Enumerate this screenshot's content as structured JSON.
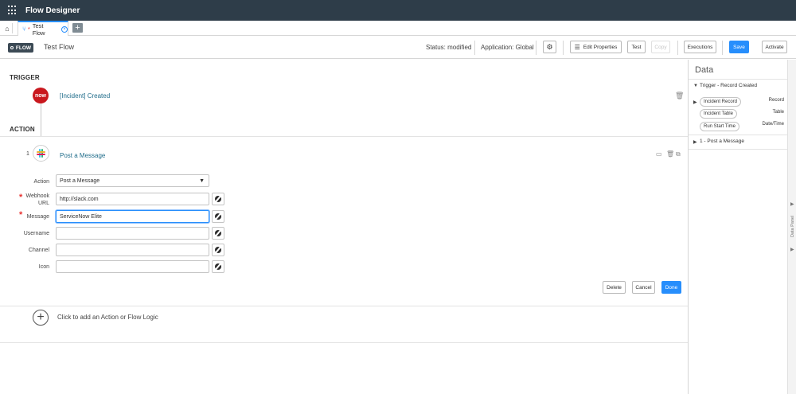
{
  "app": {
    "title": "Flow Designer"
  },
  "tabs": {
    "active_label": "Test Flow",
    "active_prefix": "*"
  },
  "header": {
    "badge": "FLOW",
    "flow_name": "Test Flow",
    "status": "Status: modified",
    "application": "Application: Global",
    "buttons": {
      "edit_properties": "Edit Properties",
      "test": "Test",
      "copy": "Copy",
      "executions": "Executions",
      "save": "Save",
      "activate": "Activate"
    }
  },
  "trigger": {
    "section": "TRIGGER",
    "logo": "now",
    "name": "[Incident] Created"
  },
  "action": {
    "section": "ACTION",
    "step_number": "1",
    "title": "Post a Message",
    "fields": {
      "action_label": "Action",
      "action_value": "Post a Message",
      "webhook_label_1": "Webhook",
      "webhook_label_2": "URL",
      "webhook_value": "http://slack.com",
      "message_label": "Message",
      "message_value": "ServiceNow Elite",
      "username_label": "Username",
      "channel_label": "Channel",
      "icon_label": "Icon"
    },
    "buttons": {
      "delete": "Delete",
      "cancel": "Cancel",
      "done": "Done"
    }
  },
  "add_step": {
    "text": "Click to add an Action or Flow Logic"
  },
  "data_panel": {
    "title": "Data",
    "trigger_section": "Trigger - Record Created",
    "pills": [
      {
        "label": "Incident Record",
        "type": "Record"
      },
      {
        "label": "Incident Table",
        "type": "Table"
      },
      {
        "label": "Run Start Time",
        "type": "Date/Time"
      }
    ],
    "action_section": "1 - Post a Message",
    "rail_label": "Data Panel"
  },
  "colors": {
    "topbar": "#2e3d49",
    "primary": "#278efc",
    "now_red": "#c9181e",
    "link": "#1f6c8a",
    "required": "#e8312f"
  }
}
